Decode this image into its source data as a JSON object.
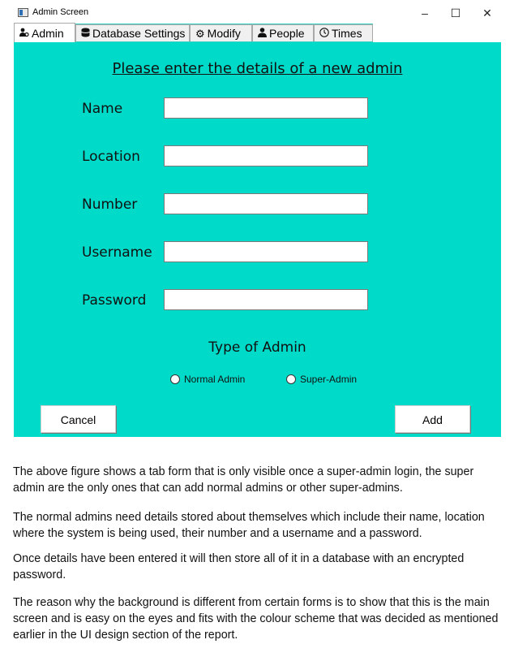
{
  "window": {
    "title": "Admin Screen",
    "minimize": "–",
    "maximize": "☐",
    "close": "✕"
  },
  "tabs": [
    {
      "label": "Admin",
      "icon": "admin-icon"
    },
    {
      "label": "Database Settings",
      "icon": "database-icon"
    },
    {
      "label": "Modify",
      "icon": "gear-icon"
    },
    {
      "label": "People",
      "icon": "person-icon"
    },
    {
      "label": "Times",
      "icon": "clock-icon"
    }
  ],
  "form": {
    "heading": "Please enter the details of a new admin",
    "fields": [
      {
        "label": "Name",
        "value": ""
      },
      {
        "label": "Location",
        "value": ""
      },
      {
        "label": "Number",
        "value": ""
      },
      {
        "label": "Username",
        "value": ""
      },
      {
        "label": "Password",
        "value": ""
      }
    ],
    "type_heading": "Type of Admin",
    "radios": [
      "Normal Admin",
      "Super-Admin"
    ],
    "cancel_label": "Cancel",
    "add_label": "Add"
  },
  "colors": {
    "panel_bg": "#00dbc9"
  },
  "document": {
    "paragraphs": [
      "The above figure shows a tab form that is only visible once a super-admin login, the super admin are the only ones that can add normal admins or other super-admins.",
      "The normal admins need details stored about themselves which include their name, location where the system is being used, their number and a username and a password.",
      "Once details have been entered it will then store all of it in a database with an encrypted password.",
      "The reason why the background is different from certain forms is to show that this is the main screen and is easy on the eyes and fits with the colour scheme that was decided as mentioned earlier in the UI design section of the report."
    ]
  }
}
